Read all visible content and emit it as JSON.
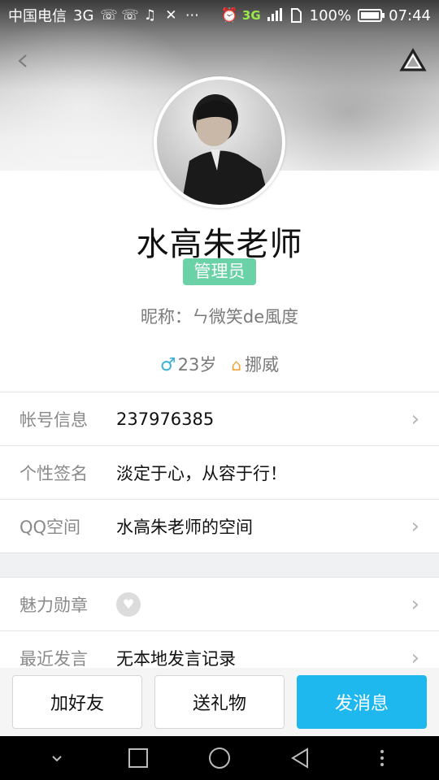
{
  "status_bar": {
    "carrier": "中国电信",
    "network_left": "3G",
    "network_right": "3G",
    "battery": "100%",
    "time": "07:44",
    "icons": [
      "missed-call-icon",
      "missed-call-icon",
      "music-icon",
      "mute-icon",
      "more-icon",
      "alarm-icon",
      "signal-icon",
      "sim-icon",
      "battery-icon"
    ]
  },
  "profile": {
    "name": "水高朱老师",
    "role_badge": "管理员",
    "nickname": "昵称：ㄣ微笑de風度",
    "age": "23岁",
    "location": "挪威"
  },
  "rows": [
    {
      "label": "帐号信息",
      "value": "237976385",
      "has_chevron": true
    },
    {
      "label": "个性签名",
      "value": "淡定于心，从容于行！",
      "has_chevron": false
    },
    {
      "label": "QQ空间",
      "value": "水高朱老师的空间",
      "has_chevron": true
    }
  ],
  "rows2": [
    {
      "label": "魅力勋章",
      "value": "",
      "has_chevron": true
    },
    {
      "label": "最近发言",
      "value": "无本地发言记录",
      "has_chevron": true
    }
  ],
  "actions": {
    "add_friend": "加好友",
    "send_gift": "送礼物",
    "send_message": "发消息"
  },
  "colors": {
    "primary": "#1fb8ee",
    "badge": "#6bd1a6",
    "gender": "#3bb0d8",
    "home": "#f0a53a"
  },
  "chevron_glyph": "›"
}
